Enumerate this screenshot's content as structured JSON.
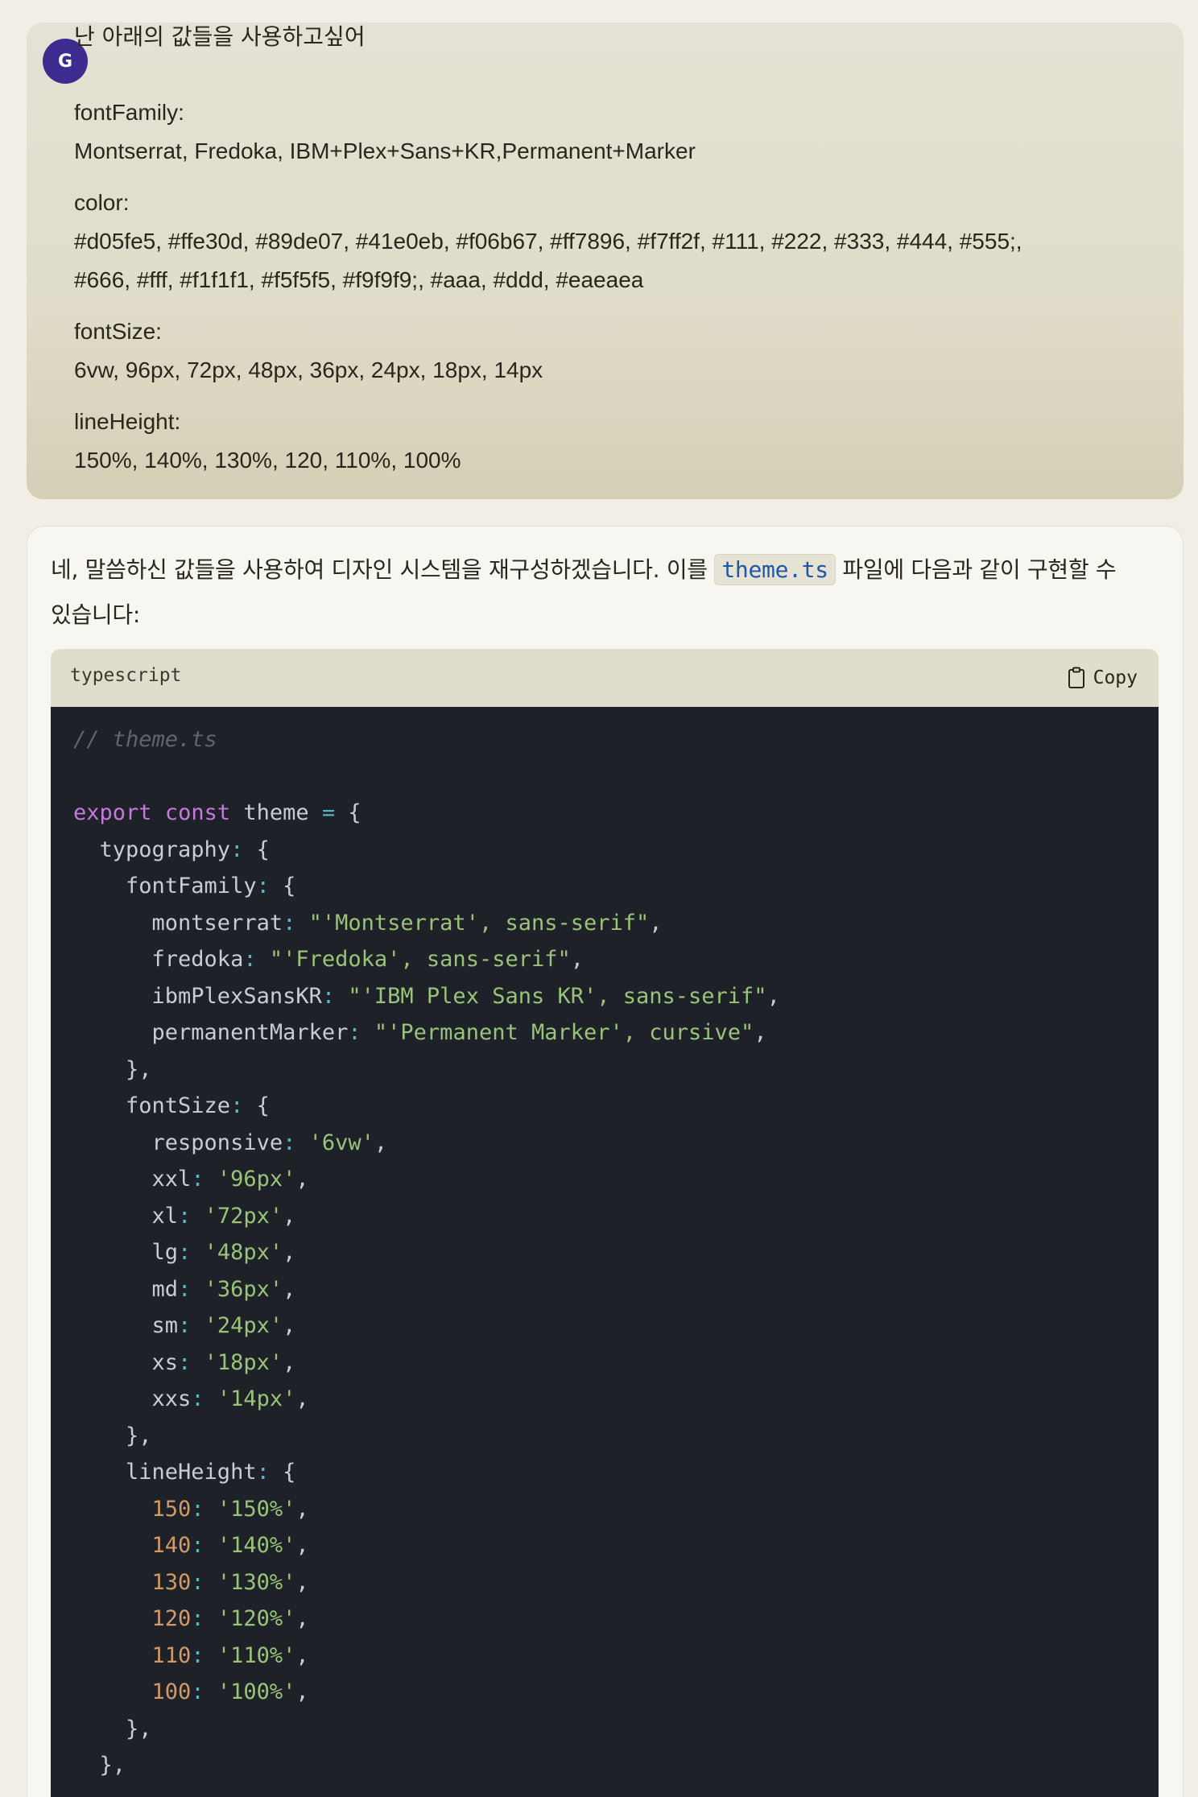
{
  "user": {
    "avatar_initial": "G",
    "message": "난 아래의 값들을 사용하고싶어",
    "lines": [
      "fontFamily:",
      "Montserrat, Fredoka, IBM+Plex+Sans+KR,Permanent+Marker",
      "color:",
      "#d05fe5, #ffe30d, #89de07, #41e0eb, #f06b67, #ff7896, #f7ff2f, #111, #222, #333, #444, #555;,",
      "#666, #fff, #f1f1f1, #f5f5f5, #f9f9f9;, #aaa, #ddd, #eaeaea",
      "fontSize:",
      "6vw, 96px, 72px, 48px, 36px, 24px, 18px, 14px",
      "lineHeight:",
      "150%, 140%, 130%, 120, 110%, 100%"
    ]
  },
  "assistant": {
    "intro_part1": "네, 말씀하신 값들을 사용하여 디자인 시스템을 재구성하겠습니다. 이를 ",
    "intro_code": "theme.ts",
    "intro_part2": " 파일에 다음과 같이 구현할 수 있습니다:",
    "code_block": {
      "language": "typescript",
      "copy_label": "Copy",
      "lines": [
        [
          {
            "t": "// theme.ts",
            "c": "comment"
          }
        ],
        [],
        [
          {
            "t": "export",
            "c": "kw"
          },
          {
            "t": " ",
            "c": "plain"
          },
          {
            "t": "const",
            "c": "kw"
          },
          {
            "t": " theme ",
            "c": "plain"
          },
          {
            "t": "=",
            "c": "punc"
          },
          {
            "t": " {",
            "c": "plain"
          }
        ],
        [
          {
            "t": "  typography",
            "c": "key"
          },
          {
            "t": ":",
            "c": "punc"
          },
          {
            "t": " {",
            "c": "plain"
          }
        ],
        [
          {
            "t": "    fontFamily",
            "c": "key"
          },
          {
            "t": ":",
            "c": "punc"
          },
          {
            "t": " {",
            "c": "plain"
          }
        ],
        [
          {
            "t": "      montserrat",
            "c": "key"
          },
          {
            "t": ":",
            "c": "punc"
          },
          {
            "t": " ",
            "c": "plain"
          },
          {
            "t": "\"'Montserrat', sans-serif\"",
            "c": "str"
          },
          {
            "t": ",",
            "c": "plain"
          }
        ],
        [
          {
            "t": "      fredoka",
            "c": "key"
          },
          {
            "t": ":",
            "c": "punc"
          },
          {
            "t": " ",
            "c": "plain"
          },
          {
            "t": "\"'Fredoka', sans-serif\"",
            "c": "str"
          },
          {
            "t": ",",
            "c": "plain"
          }
        ],
        [
          {
            "t": "      ibmPlexSansKR",
            "c": "key"
          },
          {
            "t": ":",
            "c": "punc"
          },
          {
            "t": " ",
            "c": "plain"
          },
          {
            "t": "\"'IBM Plex Sans KR', sans-serif\"",
            "c": "str"
          },
          {
            "t": ",",
            "c": "plain"
          }
        ],
        [
          {
            "t": "      permanentMarker",
            "c": "key"
          },
          {
            "t": ":",
            "c": "punc"
          },
          {
            "t": " ",
            "c": "plain"
          },
          {
            "t": "\"'Permanent Marker', cursive\"",
            "c": "str"
          },
          {
            "t": ",",
            "c": "plain"
          }
        ],
        [
          {
            "t": "    },",
            "c": "plain"
          }
        ],
        [
          {
            "t": "    fontSize",
            "c": "key"
          },
          {
            "t": ":",
            "c": "punc"
          },
          {
            "t": " {",
            "c": "plain"
          }
        ],
        [
          {
            "t": "      responsive",
            "c": "key"
          },
          {
            "t": ":",
            "c": "punc"
          },
          {
            "t": " ",
            "c": "plain"
          },
          {
            "t": "'6vw'",
            "c": "str"
          },
          {
            "t": ",",
            "c": "plain"
          }
        ],
        [
          {
            "t": "      xxl",
            "c": "key"
          },
          {
            "t": ":",
            "c": "punc"
          },
          {
            "t": " ",
            "c": "plain"
          },
          {
            "t": "'96px'",
            "c": "str"
          },
          {
            "t": ",",
            "c": "plain"
          }
        ],
        [
          {
            "t": "      xl",
            "c": "key"
          },
          {
            "t": ":",
            "c": "punc"
          },
          {
            "t": " ",
            "c": "plain"
          },
          {
            "t": "'72px'",
            "c": "str"
          },
          {
            "t": ",",
            "c": "plain"
          }
        ],
        [
          {
            "t": "      lg",
            "c": "key"
          },
          {
            "t": ":",
            "c": "punc"
          },
          {
            "t": " ",
            "c": "plain"
          },
          {
            "t": "'48px'",
            "c": "str"
          },
          {
            "t": ",",
            "c": "plain"
          }
        ],
        [
          {
            "t": "      md",
            "c": "key"
          },
          {
            "t": ":",
            "c": "punc"
          },
          {
            "t": " ",
            "c": "plain"
          },
          {
            "t": "'36px'",
            "c": "str"
          },
          {
            "t": ",",
            "c": "plain"
          }
        ],
        [
          {
            "t": "      sm",
            "c": "key"
          },
          {
            "t": ":",
            "c": "punc"
          },
          {
            "t": " ",
            "c": "plain"
          },
          {
            "t": "'24px'",
            "c": "str"
          },
          {
            "t": ",",
            "c": "plain"
          }
        ],
        [
          {
            "t": "      xs",
            "c": "key"
          },
          {
            "t": ":",
            "c": "punc"
          },
          {
            "t": " ",
            "c": "plain"
          },
          {
            "t": "'18px'",
            "c": "str"
          },
          {
            "t": ",",
            "c": "plain"
          }
        ],
        [
          {
            "t": "      xxs",
            "c": "key"
          },
          {
            "t": ":",
            "c": "punc"
          },
          {
            "t": " ",
            "c": "plain"
          },
          {
            "t": "'14px'",
            "c": "str"
          },
          {
            "t": ",",
            "c": "plain"
          }
        ],
        [
          {
            "t": "    },",
            "c": "plain"
          }
        ],
        [
          {
            "t": "    lineHeight",
            "c": "key"
          },
          {
            "t": ":",
            "c": "punc"
          },
          {
            "t": " {",
            "c": "plain"
          }
        ],
        [
          {
            "t": "      150",
            "c": "num"
          },
          {
            "t": ":",
            "c": "punc"
          },
          {
            "t": " ",
            "c": "plain"
          },
          {
            "t": "'150%'",
            "c": "str"
          },
          {
            "t": ",",
            "c": "plain"
          }
        ],
        [
          {
            "t": "      140",
            "c": "num"
          },
          {
            "t": ":",
            "c": "punc"
          },
          {
            "t": " ",
            "c": "plain"
          },
          {
            "t": "'140%'",
            "c": "str"
          },
          {
            "t": ",",
            "c": "plain"
          }
        ],
        [
          {
            "t": "      130",
            "c": "num"
          },
          {
            "t": ":",
            "c": "punc"
          },
          {
            "t": " ",
            "c": "plain"
          },
          {
            "t": "'130%'",
            "c": "str"
          },
          {
            "t": ",",
            "c": "plain"
          }
        ],
        [
          {
            "t": "      120",
            "c": "num"
          },
          {
            "t": ":",
            "c": "punc"
          },
          {
            "t": " ",
            "c": "plain"
          },
          {
            "t": "'120%'",
            "c": "str"
          },
          {
            "t": ",",
            "c": "plain"
          }
        ],
        [
          {
            "t": "      110",
            "c": "num"
          },
          {
            "t": ":",
            "c": "punc"
          },
          {
            "t": " ",
            "c": "plain"
          },
          {
            "t": "'110%'",
            "c": "str"
          },
          {
            "t": ",",
            "c": "plain"
          }
        ],
        [
          {
            "t": "      100",
            "c": "num"
          },
          {
            "t": ":",
            "c": "punc"
          },
          {
            "t": " ",
            "c": "plain"
          },
          {
            "t": "'100%'",
            "c": "str"
          },
          {
            "t": ",",
            "c": "plain"
          }
        ],
        [
          {
            "t": "    },",
            "c": "plain"
          }
        ],
        [
          {
            "t": "  },",
            "c": "plain"
          }
        ]
      ]
    }
  },
  "icons": {
    "copy": "clipboard-icon"
  }
}
